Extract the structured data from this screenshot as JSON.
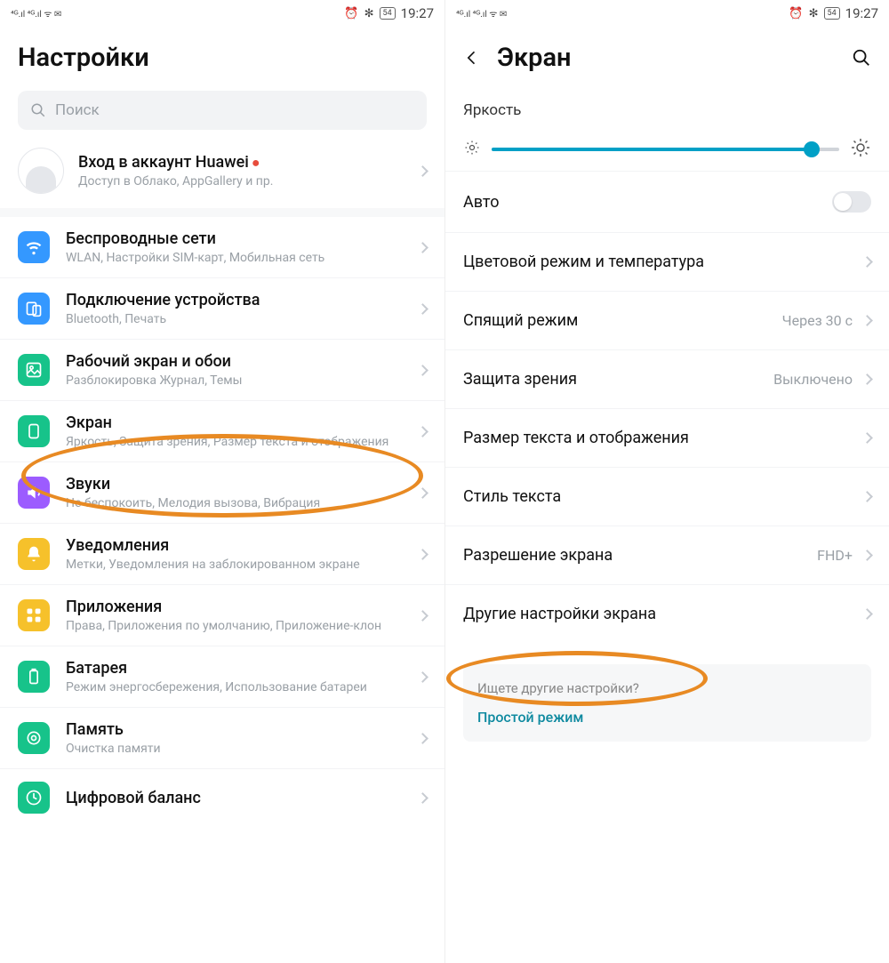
{
  "statusbar": {
    "icons_left": "⁴ᴳ.ıl ⁴ᴳ.ıl ᯤ ✉",
    "alarm": "⏰",
    "bt": "✻",
    "battery": "54",
    "time": "19:27"
  },
  "left": {
    "title": "Настройки",
    "search_placeholder": "Поиск",
    "account": {
      "title": "Вход в аккаунт Huawei",
      "subtitle": "Доступ в Облако, AppGallery и пр."
    },
    "items": [
      {
        "icon": "wifi",
        "color": "#3498ff",
        "title": "Беспроводные сети",
        "subtitle": "WLAN, Настройки SIM-карт, Мобильная сеть"
      },
      {
        "icon": "device",
        "color": "#3498ff",
        "title": "Подключение устройства",
        "subtitle": "Bluetooth, Печать"
      },
      {
        "icon": "wallpaper",
        "color": "#17c38a",
        "title": "Рабочий экран и обои",
        "subtitle": "Разблокировка Журнал, Темы"
      },
      {
        "icon": "screen",
        "color": "#17c38a",
        "title": "Экран",
        "subtitle": "Яркость, Защита зрения, Размер текста и отображения"
      },
      {
        "icon": "sound",
        "color": "#9c5cff",
        "title": "Звуки",
        "subtitle": "Не беспокоить, Мелодия вызова, Вибрация"
      },
      {
        "icon": "notif",
        "color": "#f6c12b",
        "title": "Уведомления",
        "subtitle": "Метки, Уведомления на заблокированном экране"
      },
      {
        "icon": "apps",
        "color": "#f6c12b",
        "title": "Приложения",
        "subtitle": "Права, Приложения по умолчанию, Приложение-клон"
      },
      {
        "icon": "battery",
        "color": "#17c38a",
        "title": "Батарея",
        "subtitle": "Режим энергосбережения, Использование батареи"
      },
      {
        "icon": "memory",
        "color": "#17c38a",
        "title": "Память",
        "subtitle": "Очистка памяти"
      },
      {
        "icon": "balance",
        "color": "#17c38a",
        "title": "Цифровой баланс",
        "subtitle": ""
      }
    ]
  },
  "right": {
    "title": "Экран",
    "brightness_section": "Яркость",
    "brightness_percent": 92,
    "auto_label": "Авто",
    "auto_on": false,
    "items": [
      {
        "title": "Цветовой режим и температура",
        "value": ""
      },
      {
        "title": "Спящий режим",
        "value": "Через 30 с"
      },
      {
        "title": "Защита зрения",
        "value": "Выключено"
      },
      {
        "title": "Размер текста и отображения",
        "value": ""
      },
      {
        "title": "Стиль текста",
        "value": ""
      },
      {
        "title": "Разрешение экрана",
        "value": "FHD+"
      },
      {
        "title": "Другие настройки экрана",
        "value": ""
      }
    ],
    "footer": {
      "question": "Ищете другие настройки?",
      "answer": "Простой режим"
    }
  }
}
